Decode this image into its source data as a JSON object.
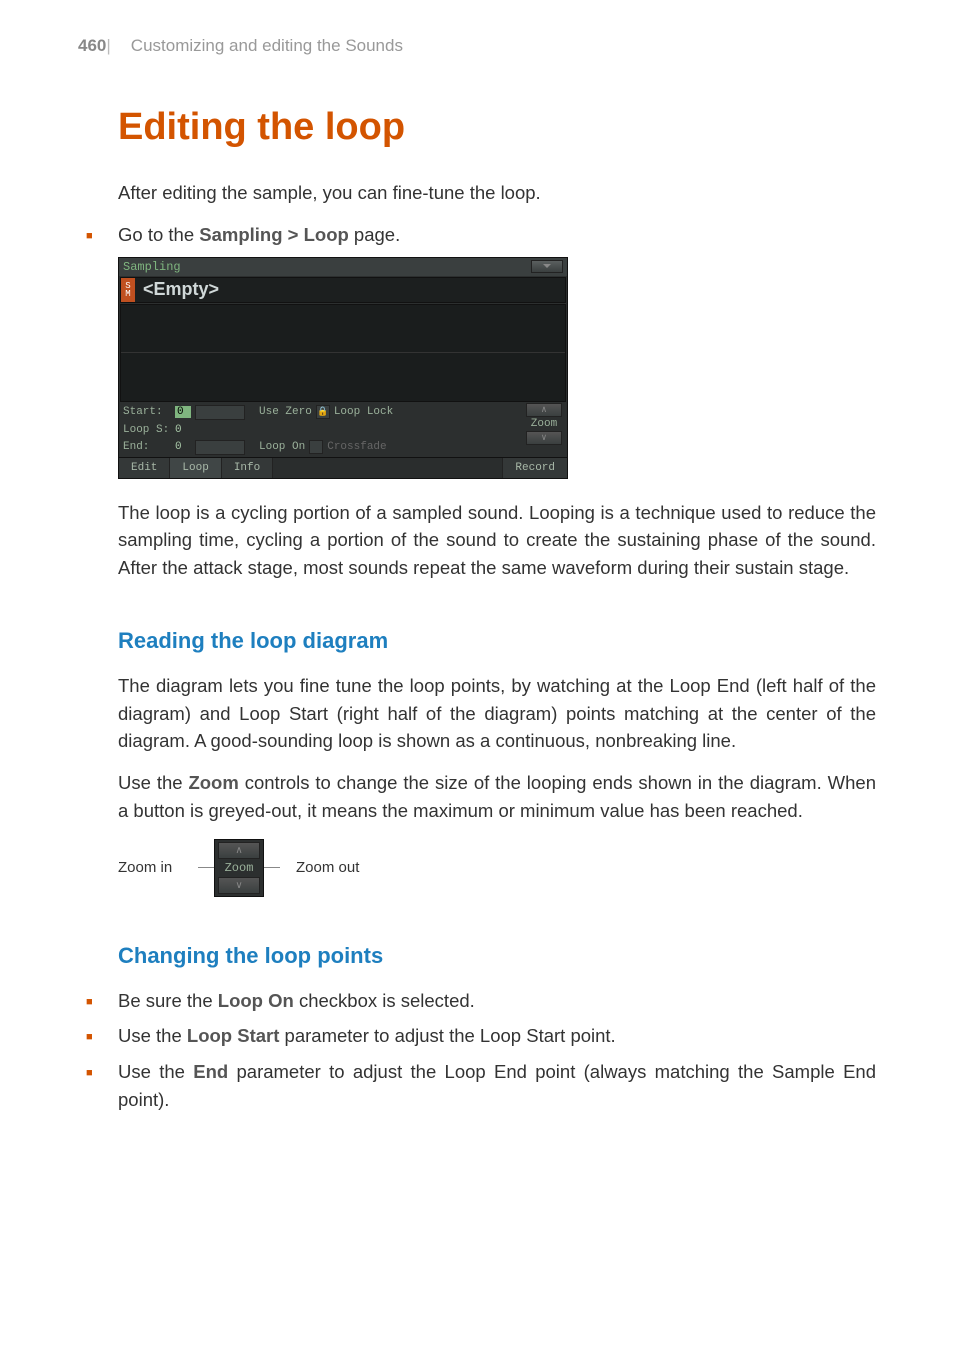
{
  "header": {
    "page_number": "460",
    "divider": "|",
    "chapter": "Customizing and editing the Sounds"
  },
  "title": "Editing the loop",
  "intro": "After editing the sample, you can fine-tune the loop.",
  "goto_prefix": "Go to the ",
  "goto_bold": "Sampling > Loop",
  "goto_suffix": " page.",
  "ui": {
    "title": "Sampling",
    "sm": "S\nM",
    "sample_name": "<Empty>",
    "start_label": "Start:",
    "start_val": "0",
    "loops_label": "Loop S:",
    "loops_val": "0",
    "end_label": "End:",
    "end_val": "0",
    "usezero": "Use Zero",
    "looplock": "Loop Lock",
    "loopon": "Loop On",
    "crossfade": "Crossfade",
    "zoom": "Zoom",
    "zoom_in_glyph": "∧",
    "zoom_out_glyph": "∨",
    "tabs": {
      "edit": "Edit",
      "loop": "Loop",
      "info": "Info",
      "record": "Record"
    }
  },
  "para_loop": "The loop is a cycling portion of a sampled sound. Looping is a technique used to reduce the sampling time, cycling a portion of the sound to create the sustaining phase of the sound. After the attack stage, most sounds repeat the same waveform during their sustain stage.",
  "h2_reading": "Reading the loop diagram",
  "para_reading": "The diagram lets you fine tune the loop points, by watching at the Loop End (left half of the diagram) and Loop Start (right half of the diagram) points matching at the center of the diagram. A good-sounding loop is shown as a continuous, nonbreaking line.",
  "para_zoom_prefix": "Use the ",
  "para_zoom_bold": "Zoom",
  "para_zoom_suffix": " controls to change the size of the looping ends shown in the diagram. When a button is greyed-out, it means the maximum or minimum value has been reached.",
  "zoom_in_label": "Zoom in",
  "zoom_out_label": "Zoom out",
  "h2_changing": "Changing the loop points",
  "b1_prefix": "Be sure the ",
  "b1_bold": "Loop On",
  "b1_suffix": " checkbox is selected.",
  "b2_prefix": "Use the ",
  "b2_bold": "Loop Start",
  "b2_suffix": " parameter to adjust the Loop Start point.",
  "b3_prefix": "Use the ",
  "b3_bold": "End",
  "b3_suffix": " parameter to adjust the Loop End point (always matching the Sample End point)."
}
